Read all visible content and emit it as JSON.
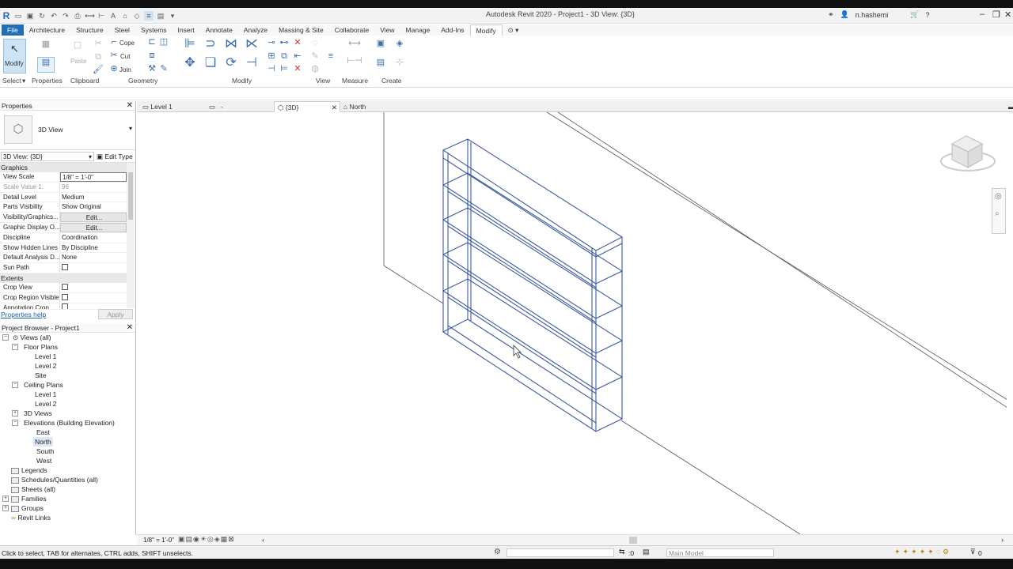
{
  "app": {
    "title": "Autodesk Revit 2020 - Project1 - 3D View: {3D}",
    "user": "n.hashemi"
  },
  "ribbon_tabs": [
    "File",
    "Architecture",
    "Structure",
    "Steel",
    "Systems",
    "Insert",
    "Annotate",
    "Analyze",
    "Massing & Site",
    "Collaborate",
    "View",
    "Manage",
    "Add-Ins",
    "Modify"
  ],
  "ribbon": {
    "modify_label": "Modify",
    "paste_label": "Paste",
    "cope_label": "Cope",
    "cut_label": "Cut",
    "join_label": "Join",
    "panels": [
      "Select",
      "Properties",
      "Clipboard",
      "Geometry",
      "Modify",
      "View",
      "Measure",
      "Create"
    ]
  },
  "properties": {
    "title": "Properties",
    "type_name": "3D View",
    "view_selector": "3D View: {3D}",
    "edit_type": "Edit Type",
    "sections": {
      "graphics": "Graphics",
      "extents": "Extents"
    },
    "rows": [
      {
        "k": "View Scale",
        "v": "1/8\" = 1'-0\""
      },
      {
        "k": "Scale Value    1:",
        "v": "96"
      },
      {
        "k": "Detail Level",
        "v": "Medium"
      },
      {
        "k": "Parts Visibility",
        "v": "Show Original"
      },
      {
        "k": "Visibility/Graphics...",
        "v": "Edit..."
      },
      {
        "k": "Graphic Display O...",
        "v": "Edit..."
      },
      {
        "k": "Discipline",
        "v": "Coordination"
      },
      {
        "k": "Show Hidden Lines",
        "v": "By Discipline"
      },
      {
        "k": "Default Analysis D...",
        "v": "None"
      },
      {
        "k": "Sun Path",
        "v": ""
      }
    ],
    "extents_rows": [
      {
        "k": "Crop View"
      },
      {
        "k": "Crop Region Visible"
      },
      {
        "k": "Annotation Crop"
      }
    ],
    "help": "Properties help",
    "apply": "Apply"
  },
  "browser": {
    "title": "Project Browser - Project1",
    "nodes": {
      "views": "Views (all)",
      "floor_plans": "Floor Plans",
      "fp_level1": "Level 1",
      "fp_level2": "Level 2",
      "fp_site": "Site",
      "ceiling_plans": "Ceiling Plans",
      "cp_level1": "Level 1",
      "cp_level2": "Level 2",
      "views3d": "3D Views",
      "elevations": "Elevations (Building Elevation)",
      "east": "East",
      "north": "North",
      "south": "South",
      "west": "West",
      "legends": "Legends",
      "schedules": "Schedules/Quantities (all)",
      "sheets": "Sheets (all)",
      "families": "Families",
      "groups": "Groups",
      "revit_links": "Revit Links"
    }
  },
  "view_tabs": {
    "level1": "Level 1",
    "dash": "-",
    "threed": "{3D}",
    "north": "North"
  },
  "view_control": {
    "scale": "1/8\" = 1'-0\""
  },
  "status": {
    "message": "Click to select, TAB for alternates, CTRL adds, SHIFT unselects.",
    "zero": ":0",
    "model": "Main Model",
    "filter_count": "0"
  },
  "colors": {
    "accent": "#1e6fb8",
    "shelf": "#3c5aa0"
  }
}
